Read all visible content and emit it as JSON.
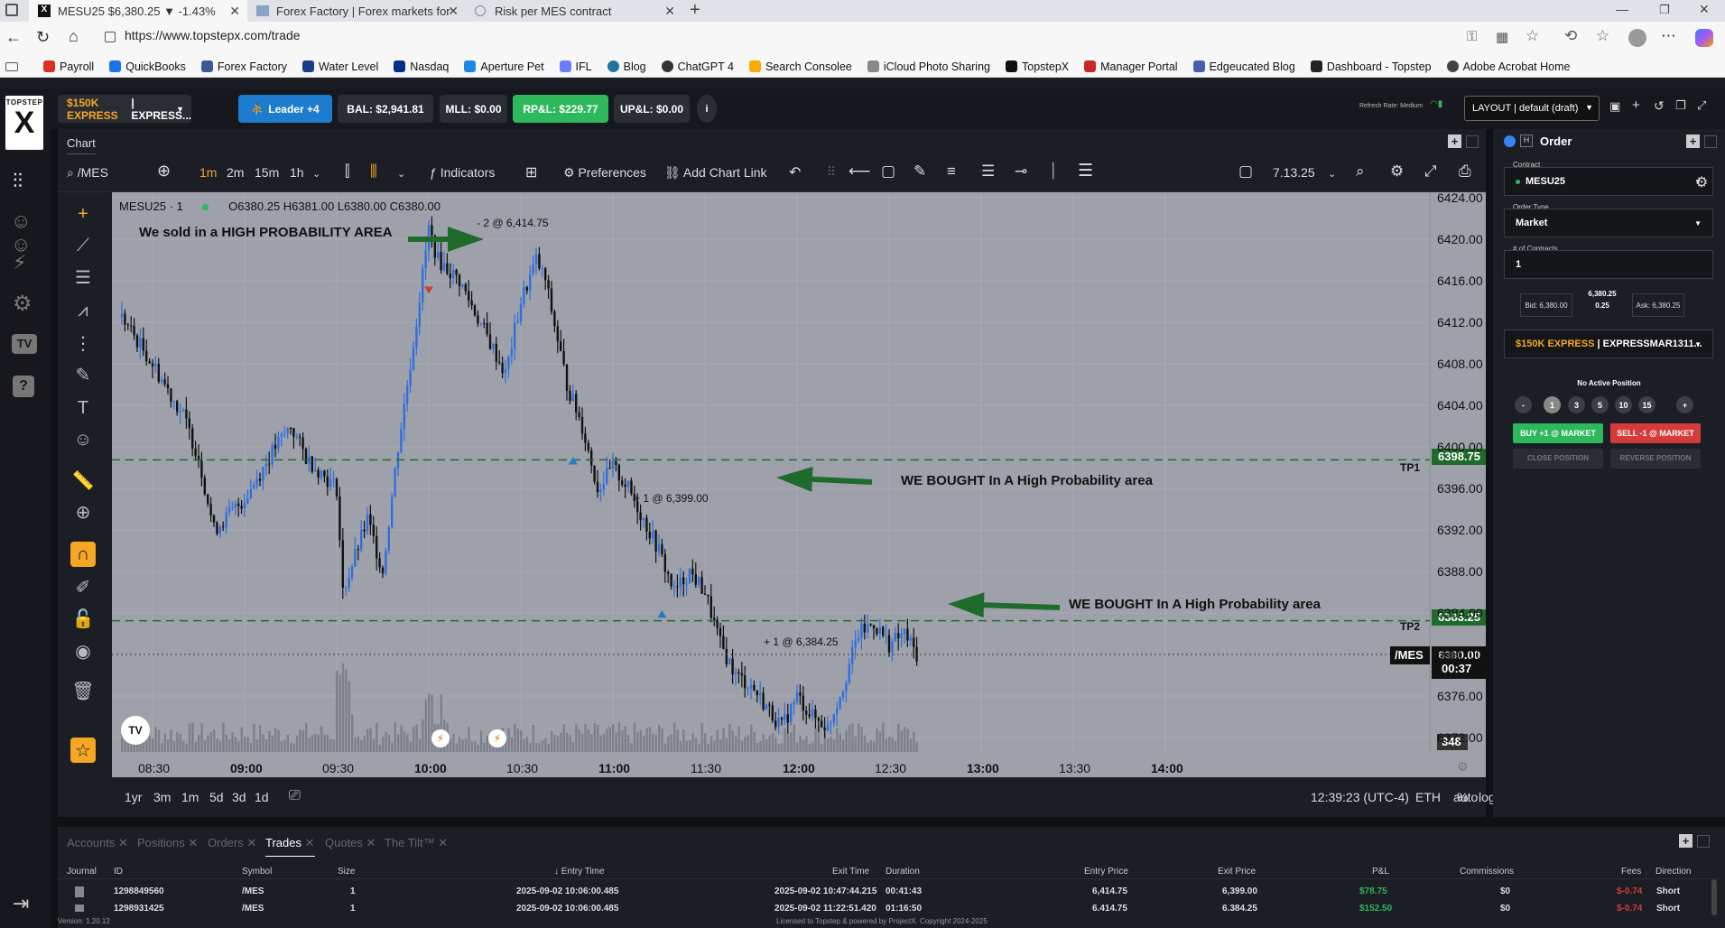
{
  "browser": {
    "tabs": [
      {
        "title": "MESU25 $6,380.25 ▼ -1.43%",
        "active": true
      },
      {
        "title": "Forex Factory | Forex markets for",
        "active": false
      },
      {
        "title": "Risk per MES contract",
        "active": false
      }
    ],
    "url": "https://www.topstepx.com/trade",
    "bookmarks": [
      {
        "label": "Payroll",
        "color": "#d93025"
      },
      {
        "label": "QuickBooks",
        "color": "#1a73e8"
      },
      {
        "label": "Forex Factory",
        "color": "#3b5998"
      },
      {
        "label": "Water Level",
        "color": "#1a3e8e"
      },
      {
        "label": "Nasdaq",
        "color": "#003087"
      },
      {
        "label": "Aperture Pet",
        "color": "#1e88e5"
      },
      {
        "label": "IFL",
        "color": "#6b7cff"
      },
      {
        "label": "Blog",
        "color": "#21759b"
      },
      {
        "label": "ChatGPT 4",
        "color": "#333333"
      },
      {
        "label": "Search Consolee",
        "color": "#f9ab00"
      },
      {
        "label": "iCloud Photo Sharing",
        "color": "#888888"
      },
      {
        "label": "TopstepX",
        "color": "#111111"
      },
      {
        "label": "Manager Portal",
        "color": "#c62828"
      },
      {
        "label": "Edgeucated Blog",
        "color": "#4a5db0"
      },
      {
        "label": "Dashboard - Topstep",
        "color": "#222222"
      },
      {
        "label": "Adobe Acrobat Home",
        "color": "#444444"
      }
    ]
  },
  "brand": {
    "top": "TOPSTEP",
    "letter": "X"
  },
  "topbar": {
    "account": "$150K EXPRESS",
    "account_suffix": "| EXPRESS...",
    "leader": "Leader +4",
    "bal": "BAL: $2,941.81",
    "mll": "MLL: $0.00",
    "rpl": "RP&L: $229.77",
    "upl": "UP&L: $0.00",
    "refresh": "Refresh Rate: Medium",
    "layout": "LAYOUT | default (draft)",
    "colors": {
      "leader": "#1d7ccd",
      "rpl": "#2eb85c"
    }
  },
  "chart": {
    "tab_label": "Chart",
    "symbol_search": "/MES",
    "timeframes": [
      "1m",
      "2m",
      "15m",
      "1h"
    ],
    "indicators": "Indicators",
    "preferences": "Preferences",
    "add_chart_link": "Add Chart Link",
    "version": "7.13.25",
    "legend": {
      "symbol": "MESU25",
      "interval": "1",
      "ohlc": "O6380.25 H6381.00 L6380.00 C6380.00"
    },
    "annotations": {
      "sold": "We sold in a HIGH PROBABILITY AREA",
      "bought1": "WE BOUGHT In A High Probability area",
      "bought2": "WE BOUGHT In A High Probability area",
      "fill_sell": "- 2 @ 6,414.75",
      "fill_buy1": "+ 1 @ 6,399.00",
      "fill_buy2": "+ 1 @ 6,384.25",
      "tp1": "TP1",
      "tp2": "TP2"
    },
    "price_tags": {
      "tp1": "6398.75",
      "tp2": "6383.25",
      "symbol": "/MES",
      "last": "6380.00",
      "countdown": "00:37",
      "volume": "348"
    },
    "ranges": [
      "1yr",
      "3m",
      "1m",
      "5d",
      "3d",
      "1d"
    ],
    "clock": "12:39:23 (UTC-4)",
    "session": "ETH",
    "scale_opts": [
      "%",
      "log",
      "auto"
    ],
    "tv_logo": "TV"
  },
  "chart_data": {
    "type": "candlestick",
    "title": "MESU25 1m",
    "y_ticks": [
      "6424.00",
      "6420.00",
      "6416.00",
      "6412.00",
      "6408.00",
      "6404.00",
      "6400.00",
      "6396.00",
      "6392.00",
      "6388.00",
      "6384.00",
      "6380.00",
      "6376.00",
      "6372.00"
    ],
    "x_ticks": [
      "08:30",
      "09:00",
      "09:30",
      "10:00",
      "10:30",
      "11:00",
      "11:30",
      "12:00",
      "12:30",
      "13:00",
      "13:30",
      "14:00"
    ],
    "ylim": [
      6370,
      6425
    ],
    "path_points": [
      [
        "08:20",
        6412.5
      ],
      [
        "08:30",
        6408
      ],
      [
        "08:40",
        6403
      ],
      [
        "08:45",
        6399
      ],
      [
        "08:50",
        6392
      ],
      [
        "09:00",
        6395
      ],
      [
        "09:10",
        6400
      ],
      [
        "09:15",
        6402
      ],
      [
        "09:20",
        6399
      ],
      [
        "09:30",
        6396
      ],
      [
        "09:32",
        6386
      ],
      [
        "09:40",
        6393
      ],
      [
        "09:45",
        6388
      ],
      [
        "09:50",
        6400
      ],
      [
        "09:55",
        6410
      ],
      [
        "10:00",
        6421
      ],
      [
        "10:03",
        6418
      ],
      [
        "10:10",
        6416
      ],
      [
        "10:20",
        6410
      ],
      [
        "10:25",
        6407
      ],
      [
        "10:30",
        6414
      ],
      [
        "10:35",
        6418
      ],
      [
        "10:38",
        6416
      ],
      [
        "10:45",
        6406
      ],
      [
        "10:50",
        6402
      ],
      [
        "10:55",
        6396
      ],
      [
        "11:00",
        6398
      ],
      [
        "11:05",
        6396
      ],
      [
        "11:10",
        6393
      ],
      [
        "11:15",
        6390
      ],
      [
        "11:20",
        6386
      ],
      [
        "11:25",
        6388
      ],
      [
        "11:30",
        6386
      ],
      [
        "11:35",
        6381
      ],
      [
        "11:40",
        6378
      ],
      [
        "11:45",
        6377
      ],
      [
        "11:50",
        6375
      ],
      [
        "11:55",
        6373
      ],
      [
        "12:00",
        6376
      ],
      [
        "12:05",
        6374
      ],
      [
        "12:10",
        6373
      ],
      [
        "12:15",
        6377
      ],
      [
        "12:20",
        6382
      ],
      [
        "12:25",
        6383
      ],
      [
        "12:30",
        6381
      ],
      [
        "12:35",
        6382
      ],
      [
        "12:39",
        6380
      ]
    ],
    "horizontal_lines": [
      {
        "label": "TP1",
        "value": 6398.75,
        "style": "dashed",
        "color": "#1f6b2c"
      },
      {
        "label": "TP2",
        "value": 6383.25,
        "style": "dashed",
        "color": "#1f6b2c"
      },
      {
        "label": "last",
        "value": 6380.0,
        "style": "dotted",
        "color": "#333333"
      }
    ],
    "fills": [
      {
        "side": "sell",
        "qty": 2,
        "price": 6414.75,
        "time": "10:00"
      },
      {
        "side": "buy",
        "qty": 1,
        "price": 6399.0,
        "time": "10:47"
      },
      {
        "side": "buy",
        "qty": 1,
        "price": 6384.25,
        "time": "11:16"
      }
    ]
  },
  "order": {
    "title": "Order",
    "contract_label": "Contract",
    "contract": "MESU25",
    "type_label": "Order Type",
    "type": "Market",
    "qty_label": "# of Contracts",
    "qty": "1",
    "bid": "Bid: 6,380.00",
    "mid": "6,380.25",
    "spread": "0.25",
    "ask": "Ask: 6,380.25",
    "account": "$150K EXPRESS",
    "account_suffix": "| EXPRESSMAR1311...",
    "no_position": "No Active Position",
    "quick_qty": [
      "-",
      "1",
      "3",
      "5",
      "10",
      "15",
      "+"
    ],
    "buy": "BUY +1 @ MARKET",
    "sell": "SELL -1 @ MARKET",
    "close": "CLOSE POSITION",
    "reverse": "REVERSE POSITION"
  },
  "trades": {
    "tabs": [
      "Accounts",
      "Positions",
      "Orders",
      "Trades",
      "Quotes",
      "The Tilt™"
    ],
    "headers": [
      "Journal",
      "ID",
      "Symbol",
      "Size",
      "Entry Time",
      "Exit Time",
      "Duration",
      "Entry Price",
      "Exit Price",
      "P&L",
      "Commissions",
      "Fees",
      "Direction"
    ],
    "rows": [
      {
        "id": "1298849560",
        "symbol": "/MES",
        "size": "1",
        "entry_time": "2025-09-02 10:06:00.485",
        "exit_time": "2025-09-02 10:47:44.215",
        "duration": "00:41:43",
        "entry_price": "6,414.75",
        "exit_price": "6,399.00",
        "pnl": "$78.75",
        "comm": "$0",
        "fees": "$-0.74",
        "dir": "Short"
      },
      {
        "id": "1298931425",
        "symbol": "/MES",
        "size": "1",
        "entry_time": "2025-09-02 10:06:00.485",
        "exit_time": "2025-09-02 11:22:51.420",
        "duration": "01:16:50",
        "entry_price": "6,414.75",
        "exit_price": "6,384.25",
        "pnl": "$152.50",
        "comm": "$0",
        "fees": "$-0.74",
        "dir": "Short"
      }
    ],
    "version": "Version: 1.20.12",
    "footer": "Licensed to Topstep & powered by ProjectX. Copyright 2024-2025"
  }
}
